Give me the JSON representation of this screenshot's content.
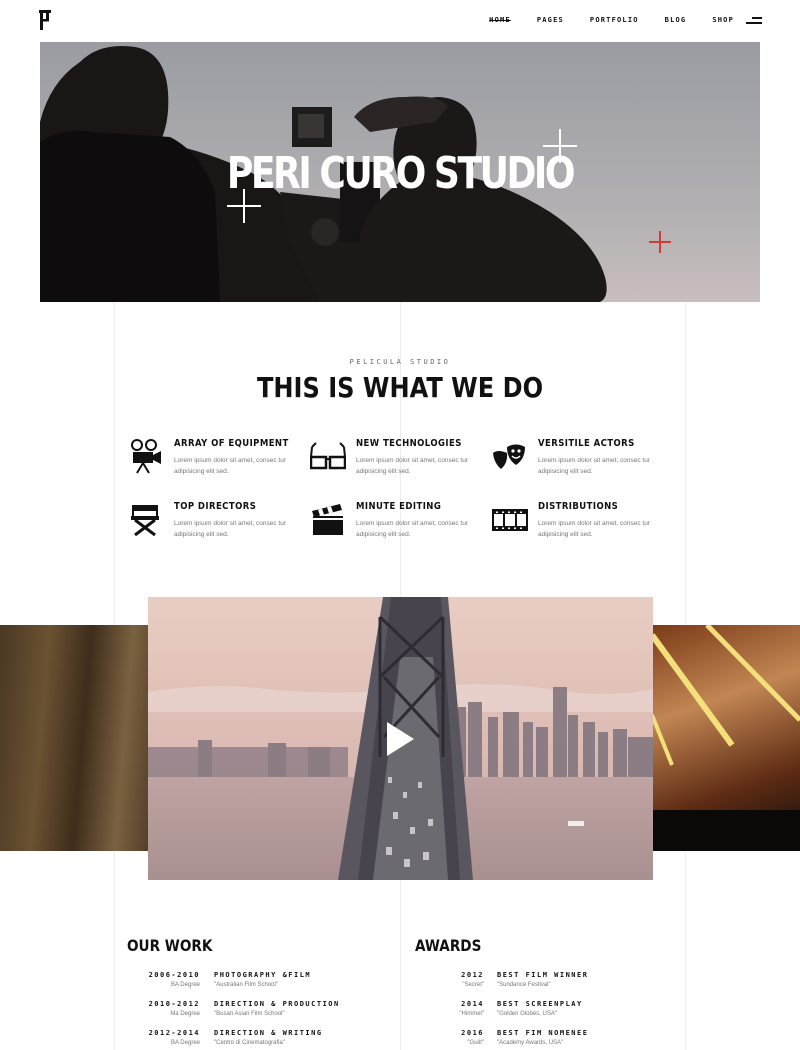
{
  "header": {
    "logo_icon": "p-monogram-logo",
    "nav": [
      {
        "label": "HOME",
        "active": true
      },
      {
        "label": "PAGES",
        "active": false
      },
      {
        "label": "PORTFOLIO",
        "active": false
      },
      {
        "label": "BLOG",
        "active": false
      },
      {
        "label": "SHOP",
        "active": false
      }
    ],
    "menu_icon": "hamburger-icon"
  },
  "hero": {
    "title": "PERI CURO STUDIO",
    "accent_color": "#d23a36"
  },
  "services": {
    "eyebrow": "PELICULA STUDIO",
    "title": "THIS IS WHAT WE DO",
    "items": [
      {
        "icon": "film-projector-icon",
        "title": "ARRAY OF EQUIPMENT",
        "text": "Lorem ipsum dolor sit amet, consec tur adipisicing elit sed."
      },
      {
        "icon": "3d-glasses-icon",
        "title": "NEW TECHNOLOGIES",
        "text": "Lorem ipsum dolor sit amet, consec tur adipisicing elit sed."
      },
      {
        "icon": "theater-masks-icon",
        "title": "VERSITILE ACTORS",
        "text": "Lorem ipsum dolor sit amet, consec tur adipisicing elit sed."
      },
      {
        "icon": "director-chair-icon",
        "title": "TOP DIRECTORS",
        "text": "Lorem ipsum dolor sit amet, consec tur adipisicing elit sed."
      },
      {
        "icon": "clapperboard-icon",
        "title": "MINUTE EDITING",
        "text": "Lorem ipsum dolor sit amet, consec tur adipisicing elit sed."
      },
      {
        "icon": "film-strip-icon",
        "title": "DISTRIBUTIONS",
        "text": "Lorem ipsum dolor sit amet, consec tur adipisicing elit sed."
      }
    ]
  },
  "video": {
    "play_icon": "play-icon"
  },
  "our_work": {
    "title": "OUR WORK",
    "rows": [
      {
        "years": "2006-2010",
        "degree": "BA Degree",
        "title": "PHOTOGRAPHY &FILM",
        "school": "\"Australian Film School\""
      },
      {
        "years": "2010-2012",
        "degree": "Ma Degree",
        "title": "DIRECTION & PRODUCTION",
        "school": "\"Busan Asian Film School\""
      },
      {
        "years": "2012-2014",
        "degree": "BA Degree",
        "title": "DIRECTION & WRITING",
        "school": "\"Centro di Cinematografia\""
      }
    ]
  },
  "awards": {
    "title": "AWARDS",
    "rows": [
      {
        "year": "2012",
        "film": "\"Secret\"",
        "title": "BEST FILM WINNER",
        "event": "\"Sundance Festival\""
      },
      {
        "year": "2014",
        "film": "\"Himmel\"",
        "title": "BEST SCREENPLAY",
        "event": "\"Golden Globes, USA\""
      },
      {
        "year": "2016",
        "film": "\"Guilt\"",
        "title": "BEST FIM NOMENEE",
        "event": "\"Academy Awards, USA\""
      }
    ]
  }
}
